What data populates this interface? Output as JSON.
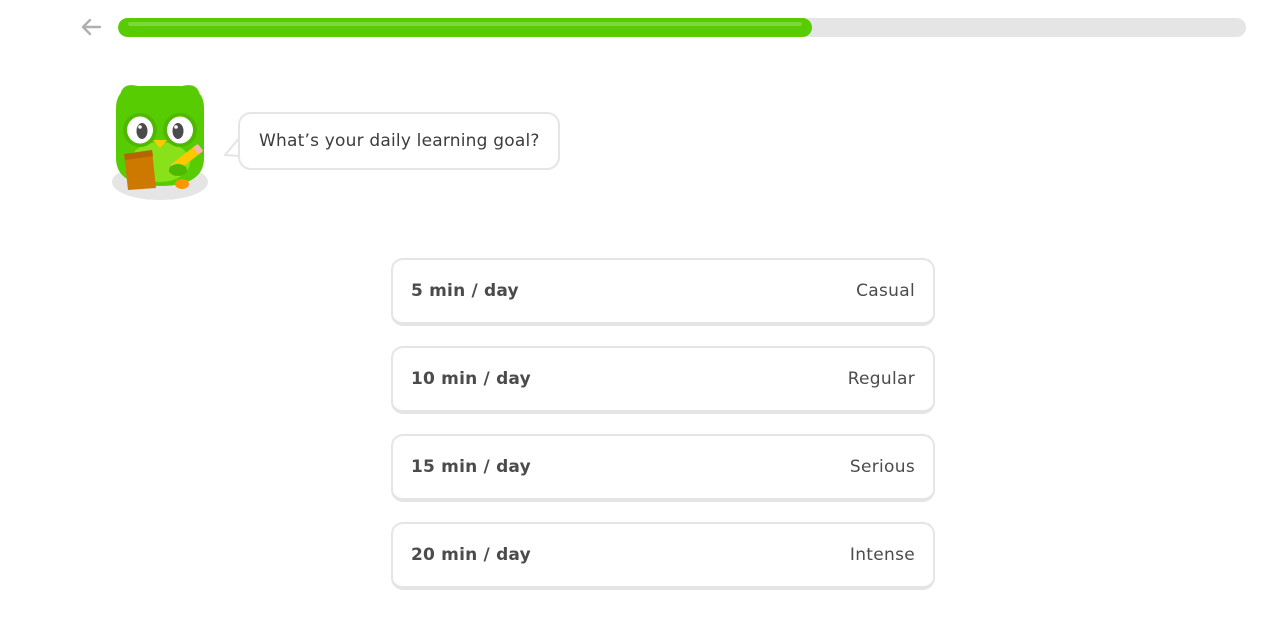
{
  "header": {
    "back_icon": "arrow-left-icon",
    "progress_fraction": 0.615,
    "progress_color": "#58cc02",
    "track_color": "#e5e5e5"
  },
  "mascot": {
    "icon": "owl-mascot-with-clipboard-icon"
  },
  "prompt": {
    "text": "What’s your daily learning goal?"
  },
  "options": [
    {
      "duration": "5 min / day",
      "level": "Casual"
    },
    {
      "duration": "10 min / day",
      "level": "Regular"
    },
    {
      "duration": "15 min / day",
      "level": "Serious"
    },
    {
      "duration": "20 min / day",
      "level": "Intense"
    }
  ]
}
